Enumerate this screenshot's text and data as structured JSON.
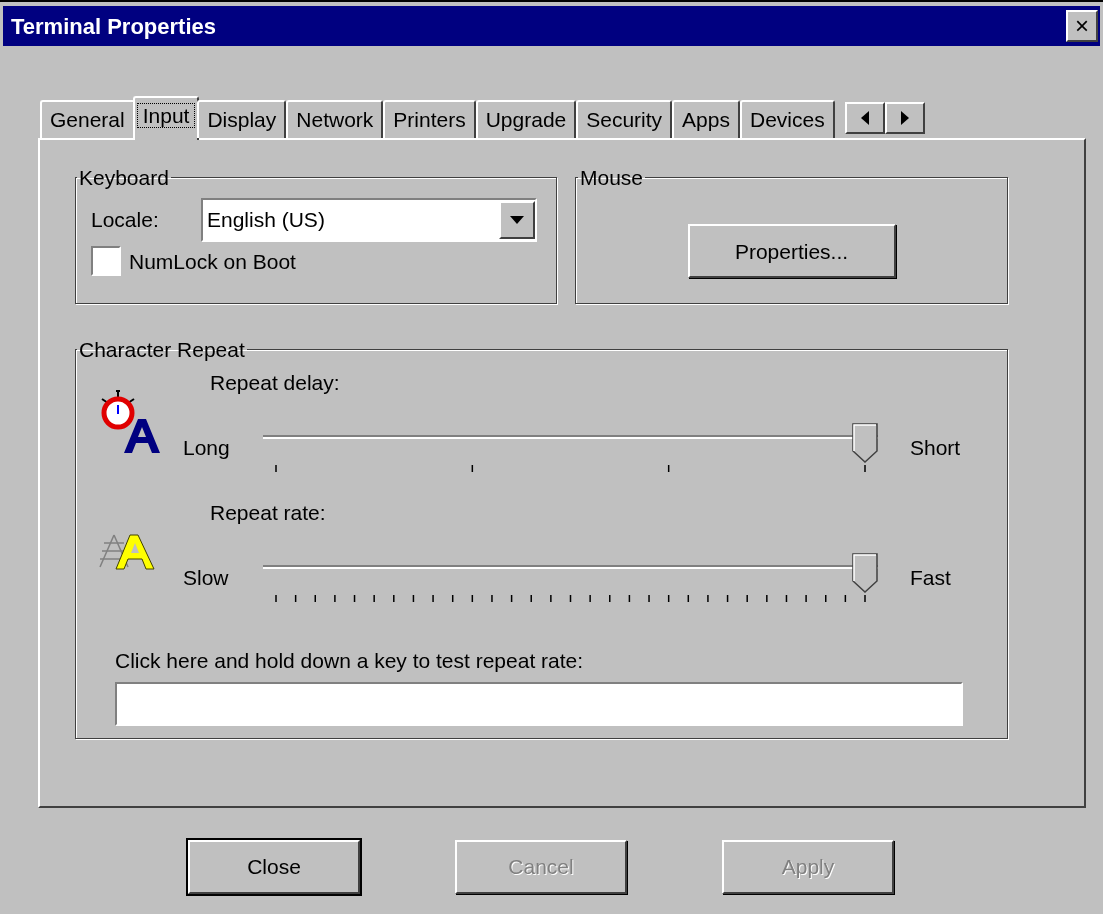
{
  "window": {
    "title": "Terminal Properties",
    "close_glyph": "×"
  },
  "tabs": [
    {
      "label": "General",
      "selected": false
    },
    {
      "label": "Input",
      "selected": true
    },
    {
      "label": "Display",
      "selected": false
    },
    {
      "label": "Network",
      "selected": false
    },
    {
      "label": "Printers",
      "selected": false
    },
    {
      "label": "Upgrade",
      "selected": false
    },
    {
      "label": "Security",
      "selected": false
    },
    {
      "label": "Apps",
      "selected": false
    },
    {
      "label": "Devices",
      "selected": false
    }
  ],
  "keyboard": {
    "title": "Keyboard",
    "locale_label": "Locale:",
    "locale_value": "English (US)",
    "numlock": {
      "label": "NumLock on Boot",
      "checked": false
    }
  },
  "mouse": {
    "title": "Mouse",
    "button": "Properties..."
  },
  "character_repeat": {
    "title": "Character Repeat",
    "sliders": [
      {
        "kind": "delay",
        "label": "Repeat delay:",
        "min_label": "Long",
        "max_label": "Short",
        "level": 1
      },
      {
        "kind": "rate",
        "label": "Repeat rate:",
        "min_label": "Slow",
        "max_label": "Fast",
        "level": 1
      }
    ],
    "test_label": "Click here and hold down a key to test repeat rate:"
  },
  "buttons": [
    {
      "label": "Close",
      "default": true,
      "disabled": false
    },
    {
      "label": "Cancel",
      "default": false,
      "disabled": true
    },
    {
      "label": "Apply",
      "default": false,
      "disabled": true
    }
  ]
}
